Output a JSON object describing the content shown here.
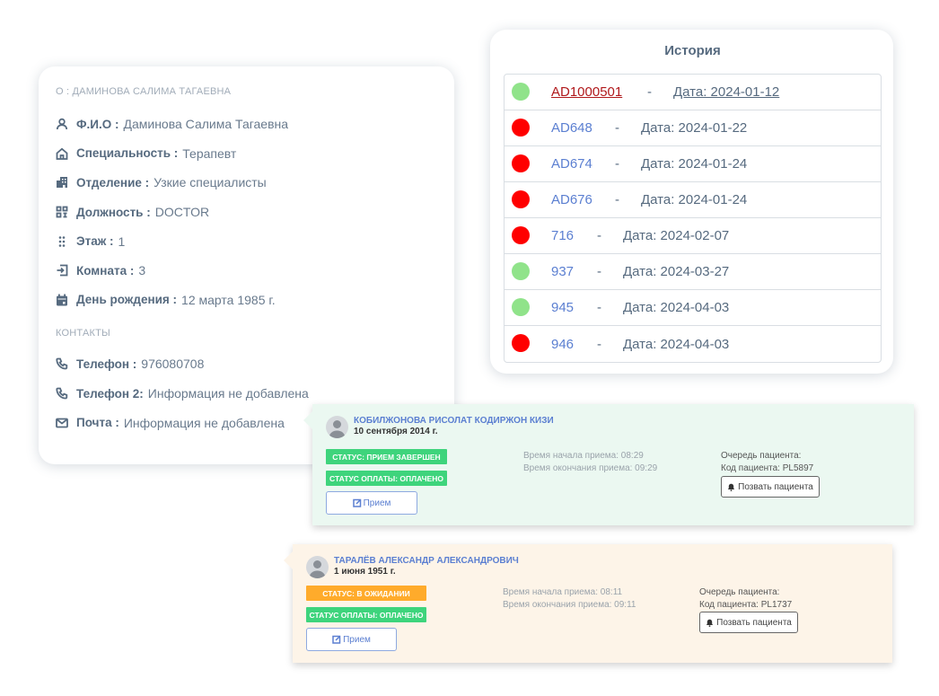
{
  "profile": {
    "header": "О : ДАМИНОВА САЛИМА ТАГАЕВНА",
    "fields": [
      {
        "icon": "user-icon",
        "label": "Ф.И.О :",
        "value": "Даминова Салима Тагаевна"
      },
      {
        "icon": "home-icon",
        "label": "Специальность :",
        "value": "Терапевт"
      },
      {
        "icon": "building-icon",
        "label": "Отделение :",
        "value": "Узкие специалисты"
      },
      {
        "icon": "grid-icon",
        "label": "Должность :",
        "value": "DOCTOR"
      },
      {
        "icon": "dots-icon",
        "label": "Этаж :",
        "value": "1"
      },
      {
        "icon": "door-enter-icon",
        "label": "Комната :",
        "value": "3"
      },
      {
        "icon": "calendar-icon",
        "label": "День рождения :",
        "value": "12 марта 1985 г."
      }
    ],
    "contacts_title": "КОНТАКТЫ",
    "contacts": [
      {
        "icon": "phone-icon",
        "label": "Телефон :",
        "value": "976080708"
      },
      {
        "icon": "phone-icon",
        "label": "Телефон 2:",
        "value": "Информация не добавлена"
      },
      {
        "icon": "mail-icon",
        "label": "Почта :",
        "value": "Информация не добавлена"
      }
    ]
  },
  "history": {
    "title": "История",
    "items": [
      {
        "id": "AD1000501",
        "date": "Дата: 2024-01-12",
        "status": "green",
        "active": true
      },
      {
        "id": "AD648",
        "date": "Дата: 2024-01-22",
        "status": "red",
        "active": false
      },
      {
        "id": "AD674",
        "date": "Дата: 2024-01-24",
        "status": "red",
        "active": false
      },
      {
        "id": "AD676",
        "date": "Дата: 2024-01-24",
        "status": "red",
        "active": false
      },
      {
        "id": "716",
        "date": "Дата: 2024-02-07",
        "status": "red",
        "active": false
      },
      {
        "id": "937",
        "date": "Дата: 2024-03-27",
        "status": "green",
        "active": false
      },
      {
        "id": "945",
        "date": "Дата: 2024-04-03",
        "status": "green",
        "active": false
      },
      {
        "id": "946",
        "date": "Дата: 2024-04-03",
        "status": "red",
        "active": false
      }
    ],
    "dash": "-"
  },
  "appointments": [
    {
      "name": "КОБИЛЖОНОВА РИСОЛАТ КОДИРЖОН КИЗИ",
      "dob": "10 сентября 2014 г.",
      "status": "СТАТУС: ПРИЕМ ЗАВЕРШЕН",
      "payment": "СТАТУС ОПЛАТЫ: ОПЛАЧЕНО",
      "button": "Прием",
      "start": "Время начала приема: 08:29",
      "end": "Время окончания приема: 09:29",
      "queue": "Очередь пациента:",
      "code": "Код пациента: PL5897",
      "call": "Позвать пациента"
    },
    {
      "name": "ТАРАЛЁВ АЛЕКСАНДР АЛЕКСАНДРОВИЧ",
      "dob": "1 июня 1951 г.",
      "status": "СТАТУС: В ОЖИДАНИИ",
      "payment": "СТАТУС ОПЛАТЫ: ОПЛАЧЕНО",
      "button": "Прием",
      "start": "Время начала приема: 08:11",
      "end": "Время окончания приема: 09:11",
      "queue": "Очередь пациента:",
      "code": "Код пациента: PL1737",
      "call": "Позвать пациента"
    }
  ],
  "colors": {
    "green_dot": "#90e38a",
    "red_dot": "#ff0000",
    "link": "#5b7fd1",
    "active_link": "#b0181b"
  }
}
